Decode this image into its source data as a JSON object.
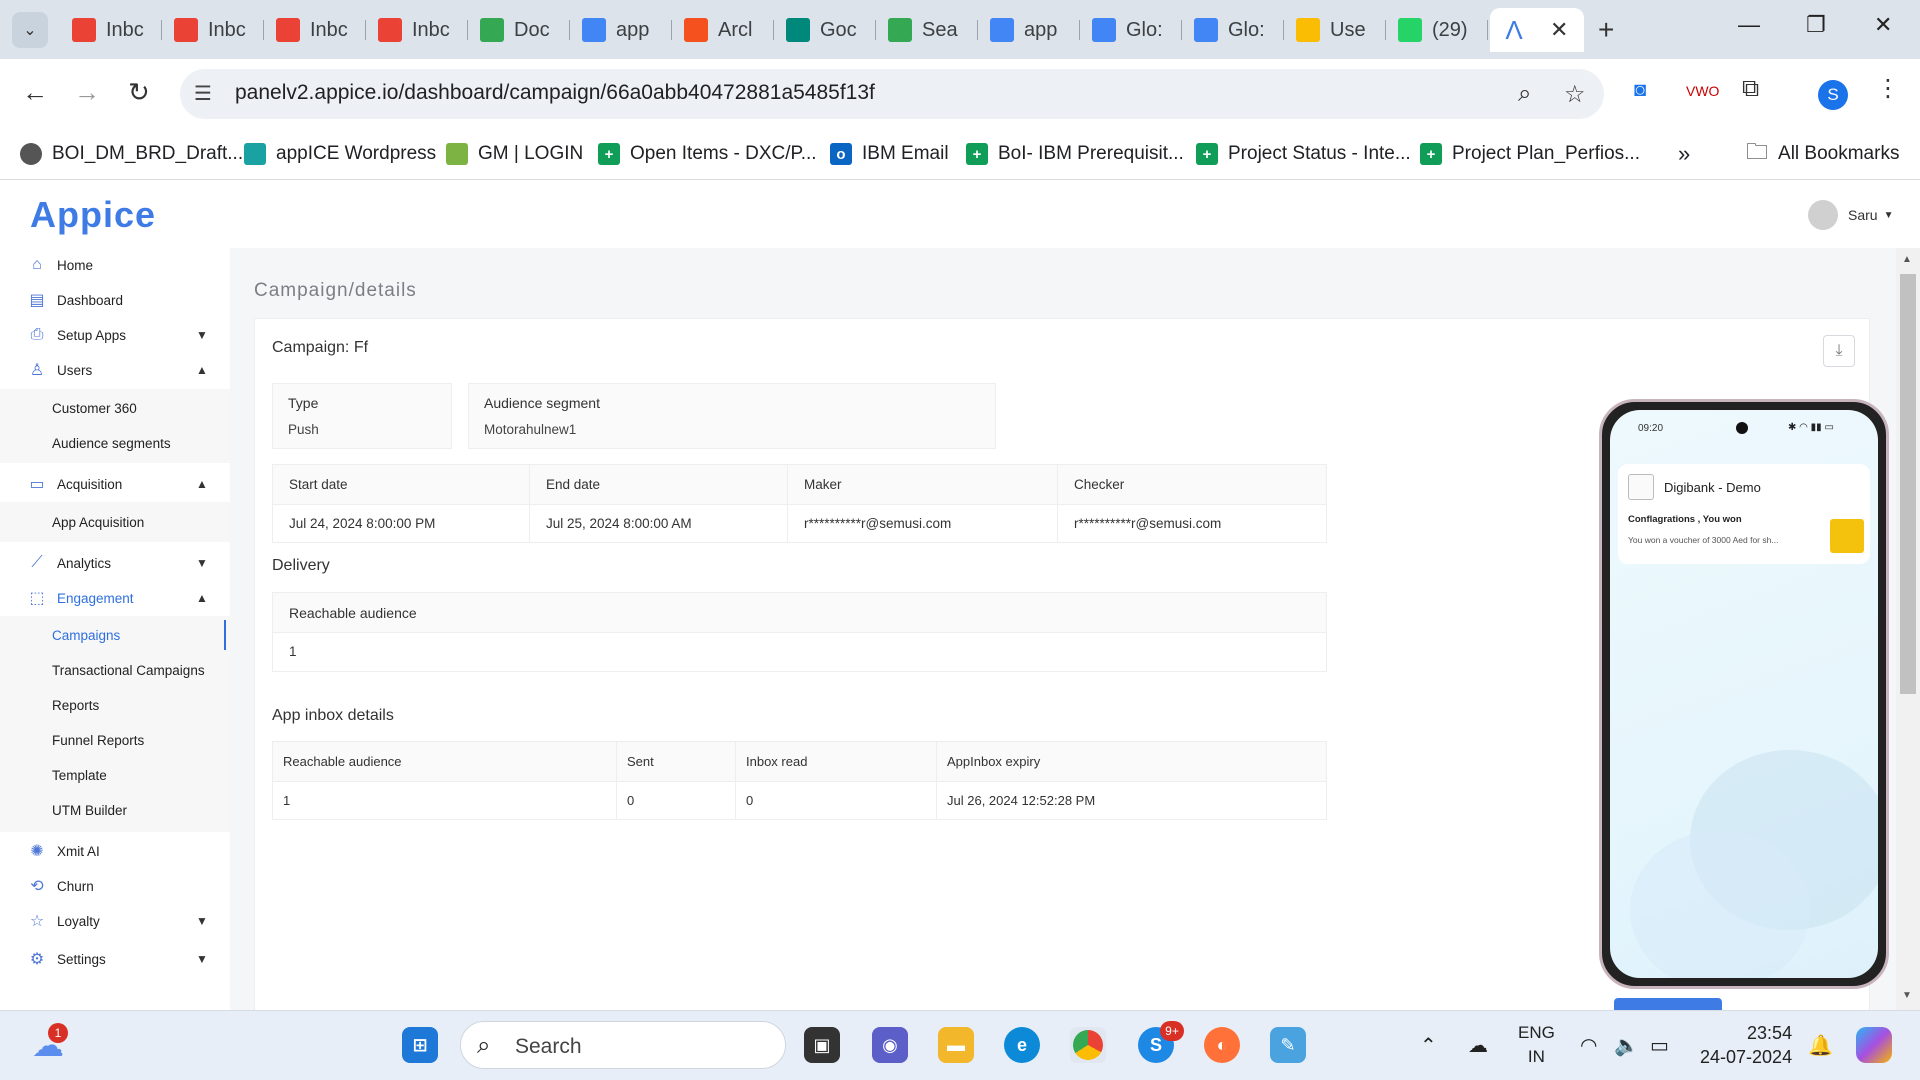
{
  "browser": {
    "tabs": [
      {
        "label": "Inbc",
        "icon": "gmail-icon",
        "color": "#ea4335"
      },
      {
        "label": "Inbc",
        "icon": "gmail-icon",
        "color": "#ea4335"
      },
      {
        "label": "Inbc",
        "icon": "gmail-icon",
        "color": "#ea4335"
      },
      {
        "label": "Inbc",
        "icon": "gmail-icon",
        "color": "#ea4335"
      },
      {
        "label": "Doc",
        "icon": "drive-icon",
        "color": "#34a853"
      },
      {
        "label": "app",
        "icon": "docs-icon",
        "color": "#4285f4"
      },
      {
        "label": "Arcl",
        "icon": "archive-icon",
        "color": "#f4511e"
      },
      {
        "label": "Goc",
        "icon": "meet-icon",
        "color": "#00897b"
      },
      {
        "label": "Sea",
        "icon": "drive-icon",
        "color": "#34a853"
      },
      {
        "label": "app",
        "icon": "docs-icon",
        "color": "#4285f4"
      },
      {
        "label": "Glo:",
        "icon": "docs-icon",
        "color": "#4285f4"
      },
      {
        "label": "Glo:",
        "icon": "docs-icon",
        "color": "#4285f4"
      },
      {
        "label": "Use",
        "icon": "ads-icon",
        "color": "#fbbc04"
      },
      {
        "label": "(29)",
        "icon": "whatsapp-icon",
        "color": "#25d366"
      }
    ],
    "url": "panelv2.appice.io/dashboard/campaign/66a0abb40472881a5485f13f",
    "profile_initial": "S",
    "bookmarks": [
      "BOI_DM_BRD_Draft...",
      "appICE Wordpress",
      "GM | LOGIN",
      "Open Items - DXC/P...",
      "IBM Email",
      "BoI- IBM Prerequisit...",
      "Project Status - Inte...",
      "Project Plan_Perfios..."
    ],
    "all_bookmarks": "All Bookmarks"
  },
  "app": {
    "logo": "Appice",
    "user": "Saru",
    "accent": "#3f7be5"
  },
  "sidebar": {
    "home": "Home",
    "dashboard": "Dashboard",
    "setup_apps": "Setup Apps",
    "users": "Users",
    "customer360": "Customer 360",
    "audience_segments": "Audience segments",
    "acquisition": "Acquisition",
    "app_acquisition": "App Acquisition",
    "analytics": "Analytics",
    "engagement": "Engagement",
    "campaigns": "Campaigns",
    "transactional": "Transactional Campaigns",
    "reports": "Reports",
    "funnel_reports": "Funnel Reports",
    "template": "Template",
    "utm_builder": "UTM Builder",
    "xmit_ai": "Xmit AI",
    "churn": "Churn",
    "loyalty": "Loyalty",
    "settings": "Settings"
  },
  "page": {
    "breadcrumb": "Campaign/details",
    "campaign_title": "Campaign: Ff",
    "type_label": "Type",
    "type_value": "Push",
    "segment_label": "Audience segment",
    "segment_value": "Motorahulnew1",
    "schedule": {
      "headers": [
        "Start date",
        "End date",
        "Maker",
        "Checker"
      ],
      "row": [
        "Jul 24, 2024 8:00:00 PM",
        "Jul 25, 2024 8:00:00 AM",
        "r**********r@semusi.com",
        "r**********r@semusi.com"
      ]
    },
    "delivery_title": "Delivery",
    "delivery_header": "Reachable audience",
    "delivery_value": "1",
    "inbox_title": "App inbox details",
    "inbox": {
      "headers": [
        "Reachable audience",
        "Sent",
        "Inbox read",
        "AppInbox expiry"
      ],
      "row": [
        "1",
        "0",
        "0",
        "Jul 26, 2024 12:52:28 PM"
      ]
    }
  },
  "phone": {
    "time": "09:20",
    "app_name": "Digibank - Demo",
    "notif_title": "Conflagrations , You won",
    "notif_body": "You won a voucher of 3000  Aed for sh..."
  },
  "taskbar": {
    "search": "Search",
    "weather_badge": "1",
    "skype_badge": "9+",
    "lang1": "ENG",
    "lang2": "IN",
    "time": "23:54",
    "date": "24-07-2024"
  }
}
